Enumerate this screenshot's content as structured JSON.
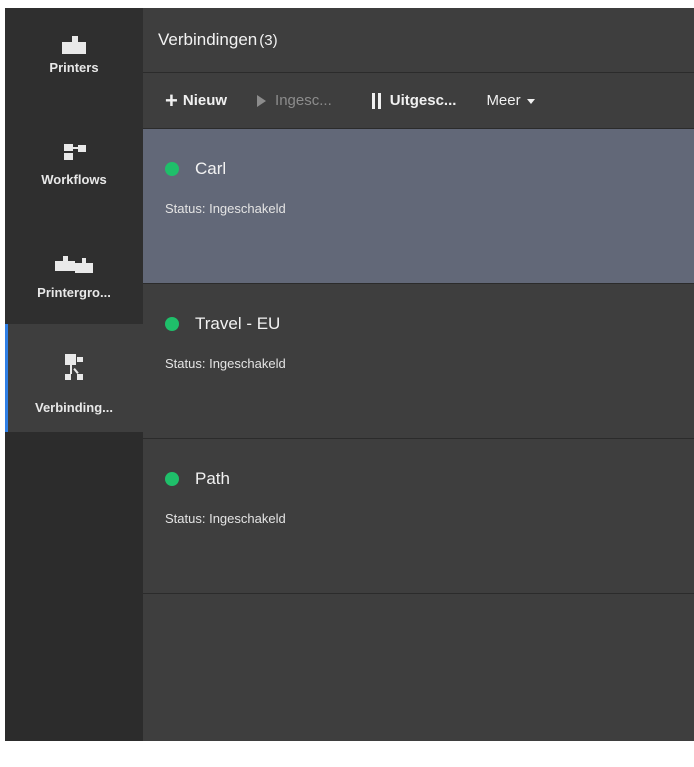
{
  "colors": {
    "accent": "#2f7fe6",
    "status_ok": "#1fbf6a",
    "selected_row": "#626878"
  },
  "nav": [
    {
      "label": "Printers",
      "icon": "printer-icon",
      "active": false
    },
    {
      "label": "Workflows",
      "icon": "workflow-icon",
      "active": false
    },
    {
      "label": "Printergro...",
      "icon": "printer-group-icon",
      "active": false
    },
    {
      "label": "Verbinding...",
      "icon": "connections-icon",
      "active": true
    }
  ],
  "header": {
    "title": "Verbindingen",
    "count": "(3)"
  },
  "toolbar": {
    "new_label": "Nieuw",
    "enable_label": "Ingesc...",
    "disable_label": "Uitgesc...",
    "more_label": "Meer"
  },
  "connections": [
    {
      "name": "Carl",
      "status": "Status: Ingeschakeld",
      "selected": true
    },
    {
      "name": "Travel - EU",
      "status": "Status: Ingeschakeld",
      "selected": false
    },
    {
      "name": "Path",
      "status": "Status: Ingeschakeld",
      "selected": false
    }
  ]
}
